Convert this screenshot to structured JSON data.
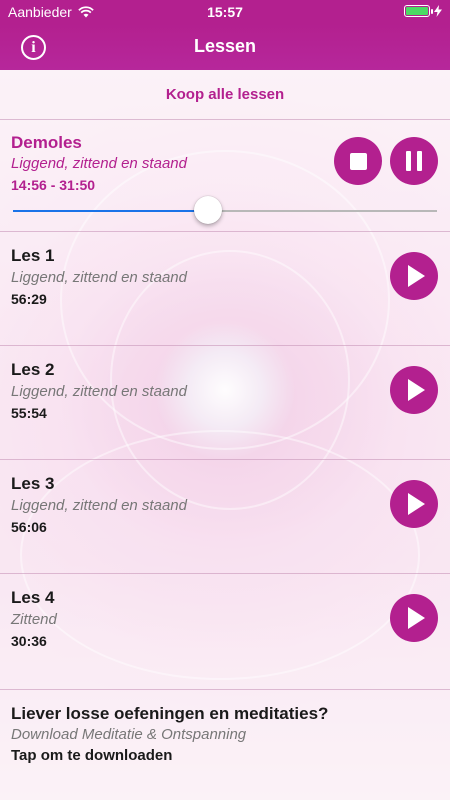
{
  "status_bar": {
    "carrier": "Aanbieder",
    "time": "15:57"
  },
  "nav": {
    "title": "Lessen",
    "info_label": "i"
  },
  "buy_all_label": "Koop alle lessen",
  "now_playing": {
    "title": "Demoles",
    "subtitle": "Liggend, zittend en staand",
    "time_display": "14:56 - 31:50",
    "progress": 0.46
  },
  "lessons": [
    {
      "title": "Les 1",
      "subtitle": "Liggend, zittend en staand",
      "duration": "56:29"
    },
    {
      "title": "Les 2",
      "subtitle": "Liggend, zittend en staand",
      "duration": "55:54"
    },
    {
      "title": "Les 3",
      "subtitle": "Liggend, zittend en staand",
      "duration": "56:06"
    },
    {
      "title": "Les 4",
      "subtitle": "Zittend",
      "duration": "30:36"
    }
  ],
  "footer": {
    "title": "Liever losse oefeningen en meditaties?",
    "subtitle": "Download Meditatie & Ontspanning",
    "action": "Tap om te downloaden"
  },
  "colors": {
    "accent": "#b3208f",
    "slider_progress": "#1a73e8"
  }
}
